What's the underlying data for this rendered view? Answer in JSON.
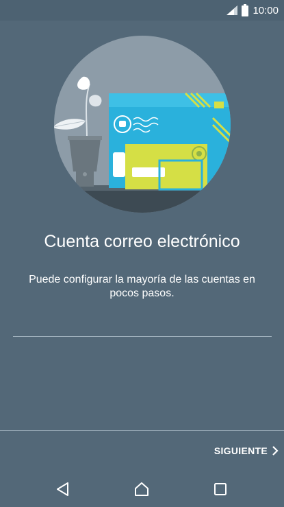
{
  "status_bar": {
    "time": "10:00",
    "icons": [
      "signal-icon",
      "battery-icon"
    ]
  },
  "hero": {
    "icon": "email-setup-illustration",
    "colors": {
      "circle": "#8d9ca8",
      "envelope_blue": "#2ab1dc",
      "envelope_yellow": "#d5df45",
      "plant_leaf": "#ffffff",
      "pot": "#68747c"
    }
  },
  "content": {
    "title": "Cuenta correo electrónico",
    "subtitle": "Puede configurar la mayoría de las cuentas en pocos pasos."
  },
  "footer": {
    "next_label": "SIGUIENTE",
    "next_icon": "chevron-right-icon"
  },
  "nav_bar": {
    "icons": [
      "back-icon",
      "home-icon",
      "recents-icon"
    ]
  },
  "colors": {
    "background": "#536878",
    "text": "#ffffff",
    "divider": "#9fb0bc"
  }
}
